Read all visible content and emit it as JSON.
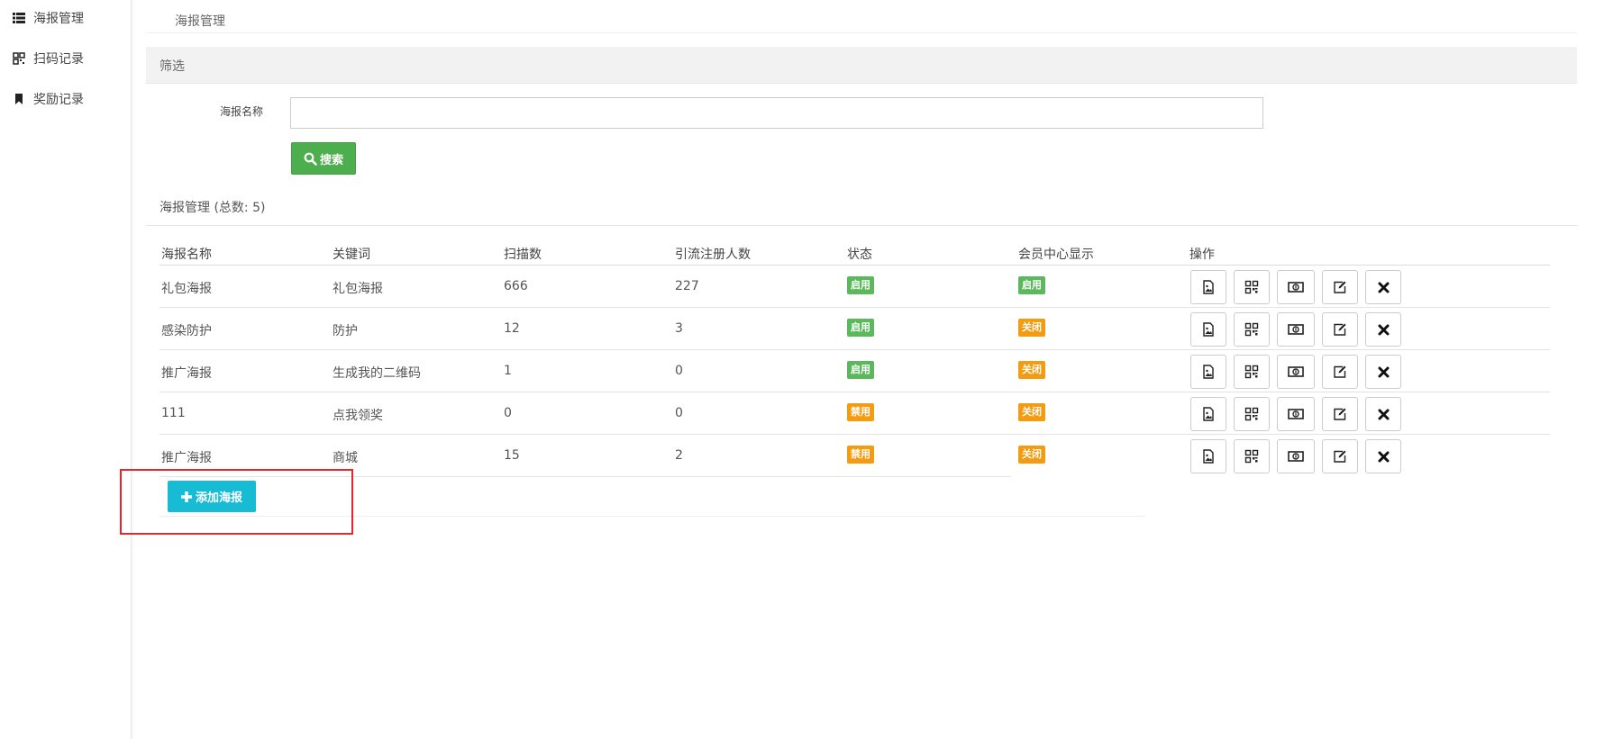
{
  "sidebar": {
    "items": [
      {
        "label": "海报管理",
        "icon": "list-icon"
      },
      {
        "label": "扫码记录",
        "icon": "qrcode-icon"
      },
      {
        "label": "奖励记录",
        "icon": "bookmark-icon"
      }
    ]
  },
  "breadcrumb": "海报管理",
  "filter": {
    "title": "筛选",
    "name_label": "海报名称",
    "name_value": "",
    "name_placeholder": "",
    "search_label": "搜索"
  },
  "section_title": "海报管理 (总数: 5)",
  "table": {
    "headers": [
      "海报名称",
      "关键词",
      "扫描数",
      "引流注册人数",
      "状态",
      "会员中心显示",
      "操作"
    ],
    "rows": [
      {
        "name": "礼包海报",
        "keyword": "礼包海报",
        "scans": "666",
        "registrations": "227",
        "status": "启用",
        "member_center": "启用"
      },
      {
        "name": "感染防护",
        "keyword": "防护",
        "scans": "12",
        "registrations": "3",
        "status": "启用",
        "member_center": "关闭"
      },
      {
        "name": "推广海报",
        "keyword": "生成我的二维码",
        "scans": "1",
        "registrations": "0",
        "status": "启用",
        "member_center": "关闭"
      },
      {
        "name": "111",
        "keyword": "点我领奖",
        "scans": "0",
        "registrations": "0",
        "status": "禁用",
        "member_center": "关闭"
      },
      {
        "name": "推广海报",
        "keyword": "商城",
        "scans": "15",
        "registrations": "2",
        "status": "禁用",
        "member_center": "关闭"
      }
    ],
    "actions": [
      "image-icon",
      "qrcode-icon",
      "money-icon",
      "edit-icon",
      "delete-icon"
    ]
  },
  "add_button_label": "添加海报",
  "colors": {
    "success": "#5cb85c",
    "warning": "#f39c12",
    "info": "#17bcd4",
    "highlight": "#e8262c"
  }
}
